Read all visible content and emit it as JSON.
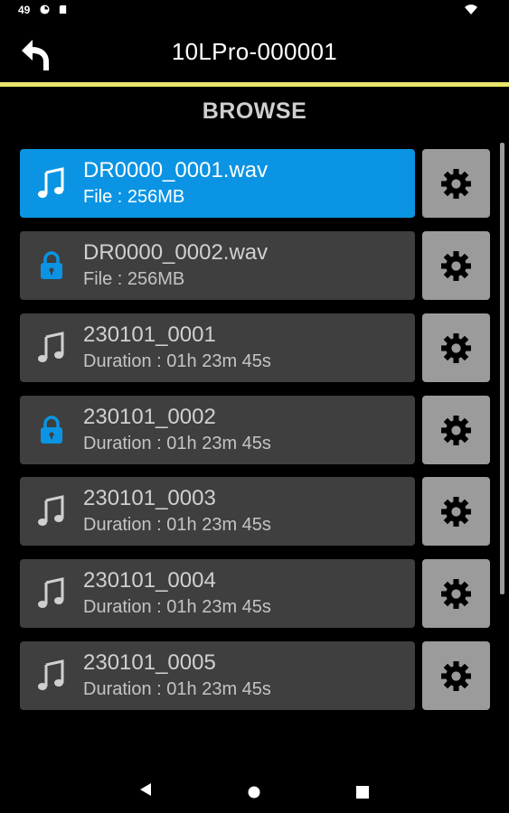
{
  "status_bar": {
    "time": "49"
  },
  "header": {
    "title": "10LPro-000001"
  },
  "section": {
    "title": "BROWSE"
  },
  "colors": {
    "accent_bar": "#e9e56a",
    "selected_card": "#0a94e3",
    "card": "#3f3f3f",
    "settings_button": "#9b9b9b",
    "lock_icon": "#0a94e3"
  },
  "files": [
    {
      "name": "DR0000_0001.wav",
      "info": "File : 256MB",
      "icon": "music-note-icon",
      "selected": true
    },
    {
      "name": "DR0000_0002.wav",
      "info": "File : 256MB",
      "icon": "lock-icon",
      "selected": false
    },
    {
      "name": "230101_0001",
      "info": "Duration : 01h 23m 45s",
      "icon": "music-note-icon",
      "selected": false
    },
    {
      "name": "230101_0002",
      "info": "Duration : 01h 23m 45s",
      "icon": "lock-icon",
      "selected": false
    },
    {
      "name": "230101_0003",
      "info": "Duration : 01h 23m 45s",
      "icon": "music-note-icon",
      "selected": false
    },
    {
      "name": "230101_0004",
      "info": "Duration : 01h 23m 45s",
      "icon": "music-note-icon",
      "selected": false
    },
    {
      "name": "230101_0005",
      "info": "Duration : 01h 23m 45s",
      "icon": "music-note-icon",
      "selected": false
    }
  ]
}
